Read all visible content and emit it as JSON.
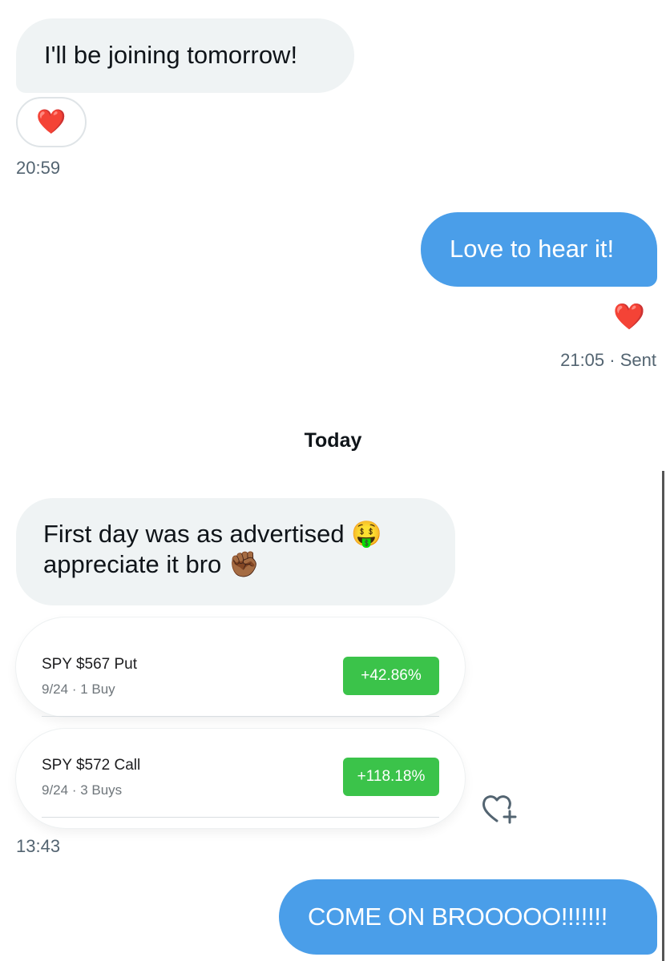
{
  "messages": {
    "m1": {
      "text": "I'll be joining tomorrow!",
      "reaction": "❤️",
      "time": "20:59"
    },
    "m2": {
      "text": "Love to hear it!",
      "reaction": "❤️",
      "time": "21:05",
      "status": "Sent"
    },
    "divider": {
      "label": "Today"
    },
    "m3": {
      "line1": "First day was as advertised",
      "emoji1": "🤑",
      "line2": "appreciate it bro",
      "emoji2": "✊🏾"
    },
    "trades": [
      {
        "title": "SPY $567 Put",
        "date": "9/24",
        "detail": "1 Buy",
        "change": "+42.86%"
      },
      {
        "title": "SPY $572 Call",
        "date": "9/24",
        "detail": "3 Buys",
        "change": "+118.18%"
      }
    ],
    "m3_time": "13:43",
    "m4": {
      "text": "COME ON BROOOOO!!!!!!!"
    }
  },
  "icons": {
    "add_reaction": "heart-plus-icon"
  },
  "colors": {
    "sent_bubble": "#4a9ee9",
    "received_bubble": "#eff3f4",
    "gain_badge": "#3bc34a"
  }
}
